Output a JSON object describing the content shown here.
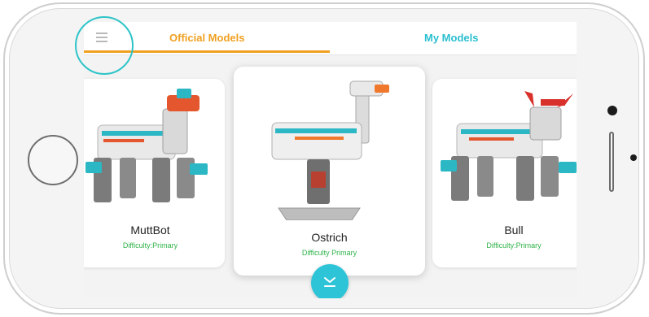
{
  "tabs": {
    "official": "Official Models",
    "mine": "My Models"
  },
  "models": [
    {
      "name": "MuttBot",
      "difficulty": "Difficulty:Primary"
    },
    {
      "name": "Ostrich",
      "difficulty": "Difficulty Primary"
    },
    {
      "name": "Bull",
      "difficulty": "Difficulty:Primary"
    }
  ],
  "colors": {
    "accent_orange": "#f0a020",
    "accent_teal": "#2bbfd0",
    "difficulty_green": "#2fb34a",
    "highlight": "#2ec4c8"
  },
  "icons": {
    "menu": "hamburger-menu-icon",
    "download": "download-icon"
  }
}
